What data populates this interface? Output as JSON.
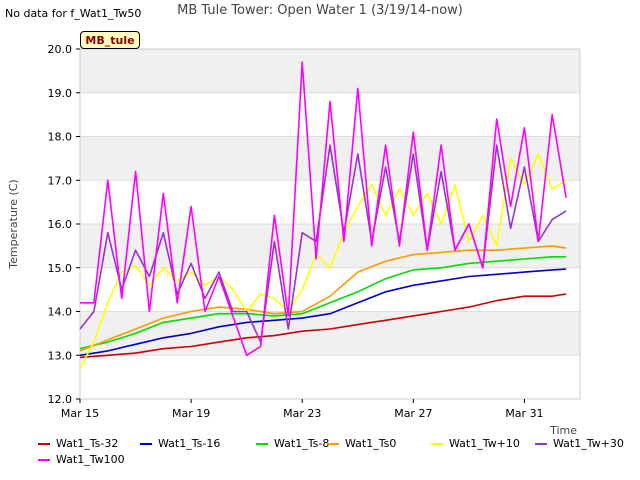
{
  "no_data_text": "No data for f_Wat1_Tw50",
  "site_badge": "MB_tule",
  "chart_data": {
    "type": "line",
    "title": "MB Tule Tower: Open Water 1 (3/19/14-now)",
    "xlabel": "Time",
    "ylabel": "Temperature (C)",
    "xlim": [
      "2014-03-15",
      "2014-04-02"
    ],
    "ylim": [
      12.0,
      20.0
    ],
    "yticks": [
      "12.0",
      "13.0",
      "14.0",
      "15.0",
      "16.0",
      "17.0",
      "18.0",
      "19.0",
      "20.0"
    ],
    "xticks": [
      {
        "x": "2014-03-15",
        "label": "Mar 15"
      },
      {
        "x": "2014-03-19",
        "label": "Mar 19"
      },
      {
        "x": "2014-03-23",
        "label": "Mar 23"
      },
      {
        "x": "2014-03-27",
        "label": "Mar 27"
      },
      {
        "x": "2014-03-31",
        "label": "Mar 31"
      }
    ],
    "band_fill": "#f0f0f0",
    "grid": true,
    "legend_position": "bottom",
    "series": [
      {
        "name": "Wat1_Ts-32",
        "color": "#cc0000",
        "points": [
          [
            "2014-03-15",
            12.95
          ],
          [
            "2014-03-16",
            13.0
          ],
          [
            "2014-03-17",
            13.05
          ],
          [
            "2014-03-18",
            13.15
          ],
          [
            "2014-03-19",
            13.2
          ],
          [
            "2014-03-20",
            13.3
          ],
          [
            "2014-03-21",
            13.4
          ],
          [
            "2014-03-22",
            13.45
          ],
          [
            "2014-03-23",
            13.55
          ],
          [
            "2014-03-24",
            13.6
          ],
          [
            "2014-03-25",
            13.7
          ],
          [
            "2014-03-26",
            13.8
          ],
          [
            "2014-03-27",
            13.9
          ],
          [
            "2014-03-28",
            14.0
          ],
          [
            "2014-03-29",
            14.1
          ],
          [
            "2014-03-30",
            14.25
          ],
          [
            "2014-03-31",
            14.35
          ],
          [
            "2014-04-01",
            14.35
          ],
          [
            "2014-04-01T12:00",
            14.4
          ]
        ]
      },
      {
        "name": "Wat1_Ts-16",
        "color": "#0000cc",
        "points": [
          [
            "2014-03-15",
            13.0
          ],
          [
            "2014-03-16",
            13.1
          ],
          [
            "2014-03-17",
            13.25
          ],
          [
            "2014-03-18",
            13.4
          ],
          [
            "2014-03-19",
            13.5
          ],
          [
            "2014-03-20",
            13.65
          ],
          [
            "2014-03-21",
            13.75
          ],
          [
            "2014-03-22",
            13.8
          ],
          [
            "2014-03-23",
            13.85
          ],
          [
            "2014-03-24",
            13.95
          ],
          [
            "2014-03-25",
            14.2
          ],
          [
            "2014-03-26",
            14.45
          ],
          [
            "2014-03-27",
            14.6
          ],
          [
            "2014-03-28",
            14.7
          ],
          [
            "2014-03-29",
            14.8
          ],
          [
            "2014-03-30",
            14.85
          ],
          [
            "2014-03-31",
            14.9
          ],
          [
            "2014-04-01",
            14.95
          ],
          [
            "2014-04-01T12:00",
            14.97
          ]
        ]
      },
      {
        "name": "Wat1_Ts-8",
        "color": "#00dd00",
        "points": [
          [
            "2014-03-15",
            13.15
          ],
          [
            "2014-03-16",
            13.3
          ],
          [
            "2014-03-17",
            13.5
          ],
          [
            "2014-03-18",
            13.75
          ],
          [
            "2014-03-19",
            13.85
          ],
          [
            "2014-03-20",
            13.95
          ],
          [
            "2014-03-21",
            13.95
          ],
          [
            "2014-03-22",
            13.9
          ],
          [
            "2014-03-23",
            13.95
          ],
          [
            "2014-03-24",
            14.2
          ],
          [
            "2014-03-25",
            14.45
          ],
          [
            "2014-03-26",
            14.75
          ],
          [
            "2014-03-27",
            14.95
          ],
          [
            "2014-03-28",
            15.0
          ],
          [
            "2014-03-29",
            15.1
          ],
          [
            "2014-03-30",
            15.15
          ],
          [
            "2014-03-31",
            15.2
          ],
          [
            "2014-04-01",
            15.25
          ],
          [
            "2014-04-01T12:00",
            15.25
          ]
        ]
      },
      {
        "name": "Wat1_Ts0",
        "color": "#ff9900",
        "points": [
          [
            "2014-03-15",
            13.1
          ],
          [
            "2014-03-16",
            13.35
          ],
          [
            "2014-03-17",
            13.6
          ],
          [
            "2014-03-18",
            13.85
          ],
          [
            "2014-03-19",
            14.0
          ],
          [
            "2014-03-20",
            14.1
          ],
          [
            "2014-03-21",
            14.05
          ],
          [
            "2014-03-22",
            13.95
          ],
          [
            "2014-03-23",
            14.0
          ],
          [
            "2014-03-24",
            14.35
          ],
          [
            "2014-03-25",
            14.9
          ],
          [
            "2014-03-26",
            15.15
          ],
          [
            "2014-03-27",
            15.3
          ],
          [
            "2014-03-28",
            15.35
          ],
          [
            "2014-03-29",
            15.4
          ],
          [
            "2014-03-30",
            15.4
          ],
          [
            "2014-03-31",
            15.45
          ],
          [
            "2014-04-01",
            15.5
          ],
          [
            "2014-04-01T12:00",
            15.45
          ]
        ]
      },
      {
        "name": "Wat1_Tw+10",
        "color": "#ffff00",
        "points": [
          [
            "2014-03-15",
            12.7
          ],
          [
            "2014-03-15T12:00",
            13.3
          ],
          [
            "2014-03-16",
            14.2
          ],
          [
            "2014-03-16T12:00",
            14.9
          ],
          [
            "2014-03-17",
            15.05
          ],
          [
            "2014-03-17T12:00",
            14.6
          ],
          [
            "2014-03-18",
            15.0
          ],
          [
            "2014-03-18T12:00",
            14.7
          ],
          [
            "2014-03-19",
            14.9
          ],
          [
            "2014-03-19T12:00",
            14.6
          ],
          [
            "2014-03-20",
            14.8
          ],
          [
            "2014-03-20T12:00",
            14.5
          ],
          [
            "2014-03-21",
            14.0
          ],
          [
            "2014-03-21T12:00",
            14.4
          ],
          [
            "2014-03-22",
            14.3
          ],
          [
            "2014-03-22T12:00",
            14.0
          ],
          [
            "2014-03-23",
            14.5
          ],
          [
            "2014-03-23T12:00",
            15.3
          ],
          [
            "2014-03-24",
            15.0
          ],
          [
            "2014-03-24T12:00",
            15.8
          ],
          [
            "2014-03-25",
            16.4
          ],
          [
            "2014-03-25T12:00",
            16.9
          ],
          [
            "2014-03-26",
            16.2
          ],
          [
            "2014-03-26T12:00",
            16.8
          ],
          [
            "2014-03-27",
            16.2
          ],
          [
            "2014-03-27T12:00",
            16.7
          ],
          [
            "2014-03-28",
            16.0
          ],
          [
            "2014-03-28T12:00",
            16.9
          ],
          [
            "2014-03-29",
            15.6
          ],
          [
            "2014-03-29T12:00",
            16.2
          ],
          [
            "2014-03-30",
            15.5
          ],
          [
            "2014-03-30T12:00",
            17.5
          ],
          [
            "2014-03-31",
            16.9
          ],
          [
            "2014-03-31T12:00",
            17.6
          ],
          [
            "2014-04-01",
            16.8
          ],
          [
            "2014-04-01T12:00",
            17.0
          ]
        ]
      },
      {
        "name": "Wat1_Tw+30",
        "color": "#9933cc",
        "points": [
          [
            "2014-03-15",
            13.6
          ],
          [
            "2014-03-15T12:00",
            14.0
          ],
          [
            "2014-03-16",
            15.8
          ],
          [
            "2014-03-16T12:00",
            14.5
          ],
          [
            "2014-03-17",
            15.4
          ],
          [
            "2014-03-17T12:00",
            14.8
          ],
          [
            "2014-03-18",
            15.8
          ],
          [
            "2014-03-18T12:00",
            14.4
          ],
          [
            "2014-03-19",
            15.1
          ],
          [
            "2014-03-19T12:00",
            14.3
          ],
          [
            "2014-03-20",
            14.9
          ],
          [
            "2014-03-20T12:00",
            14.0
          ],
          [
            "2014-03-21",
            14.0
          ],
          [
            "2014-03-21T12:00",
            13.3
          ],
          [
            "2014-03-22",
            15.6
          ],
          [
            "2014-03-22T12:00",
            13.6
          ],
          [
            "2014-03-23",
            15.8
          ],
          [
            "2014-03-23T12:00",
            15.6
          ],
          [
            "2014-03-24",
            17.8
          ],
          [
            "2014-03-24T12:00",
            15.8
          ],
          [
            "2014-03-25",
            17.6
          ],
          [
            "2014-03-25T12:00",
            15.6
          ],
          [
            "2014-03-26",
            17.3
          ],
          [
            "2014-03-26T12:00",
            15.6
          ],
          [
            "2014-03-27",
            17.6
          ],
          [
            "2014-03-27T12:00",
            15.4
          ],
          [
            "2014-03-28",
            17.2
          ],
          [
            "2014-03-28T12:00",
            15.4
          ],
          [
            "2014-03-29",
            16.0
          ],
          [
            "2014-03-29T12:00",
            15.0
          ],
          [
            "2014-03-30",
            17.8
          ],
          [
            "2014-03-30T12:00",
            15.9
          ],
          [
            "2014-03-31",
            17.3
          ],
          [
            "2014-03-31T12:00",
            15.6
          ],
          [
            "2014-04-01",
            16.1
          ],
          [
            "2014-04-01T12:00",
            16.3
          ]
        ]
      },
      {
        "name": "Wat1_Tw100",
        "color": "#ff00ff",
        "points": [
          [
            "2014-03-15",
            14.2
          ],
          [
            "2014-03-15T12:00",
            14.2
          ],
          [
            "2014-03-16",
            17.0
          ],
          [
            "2014-03-16T12:00",
            14.3
          ],
          [
            "2014-03-17",
            17.2
          ],
          [
            "2014-03-17T12:00",
            14.0
          ],
          [
            "2014-03-18",
            16.7
          ],
          [
            "2014-03-18T12:00",
            14.2
          ],
          [
            "2014-03-19",
            16.4
          ],
          [
            "2014-03-19T12:00",
            14.0
          ],
          [
            "2014-03-20",
            14.8
          ],
          [
            "2014-03-20T12:00",
            13.9
          ],
          [
            "2014-03-21",
            13.0
          ],
          [
            "2014-03-21T12:00",
            13.2
          ],
          [
            "2014-03-22",
            16.2
          ],
          [
            "2014-03-22T12:00",
            13.9
          ],
          [
            "2014-03-23",
            19.7
          ],
          [
            "2014-03-23T12:00",
            15.2
          ],
          [
            "2014-03-24",
            18.8
          ],
          [
            "2014-03-24T12:00",
            15.6
          ],
          [
            "2014-03-25",
            19.1
          ],
          [
            "2014-03-25T12:00",
            15.5
          ],
          [
            "2014-03-26",
            17.8
          ],
          [
            "2014-03-26T12:00",
            15.5
          ],
          [
            "2014-03-27",
            18.1
          ],
          [
            "2014-03-27T12:00",
            15.4
          ],
          [
            "2014-03-28",
            17.8
          ],
          [
            "2014-03-28T12:00",
            15.4
          ],
          [
            "2014-03-29",
            16.0
          ],
          [
            "2014-03-29T12:00",
            15.0
          ],
          [
            "2014-03-30",
            18.4
          ],
          [
            "2014-03-30T12:00",
            16.4
          ],
          [
            "2014-03-31",
            18.2
          ],
          [
            "2014-03-31T12:00",
            15.6
          ],
          [
            "2014-04-01",
            18.5
          ],
          [
            "2014-04-01T12:00",
            16.6
          ]
        ]
      }
    ]
  }
}
